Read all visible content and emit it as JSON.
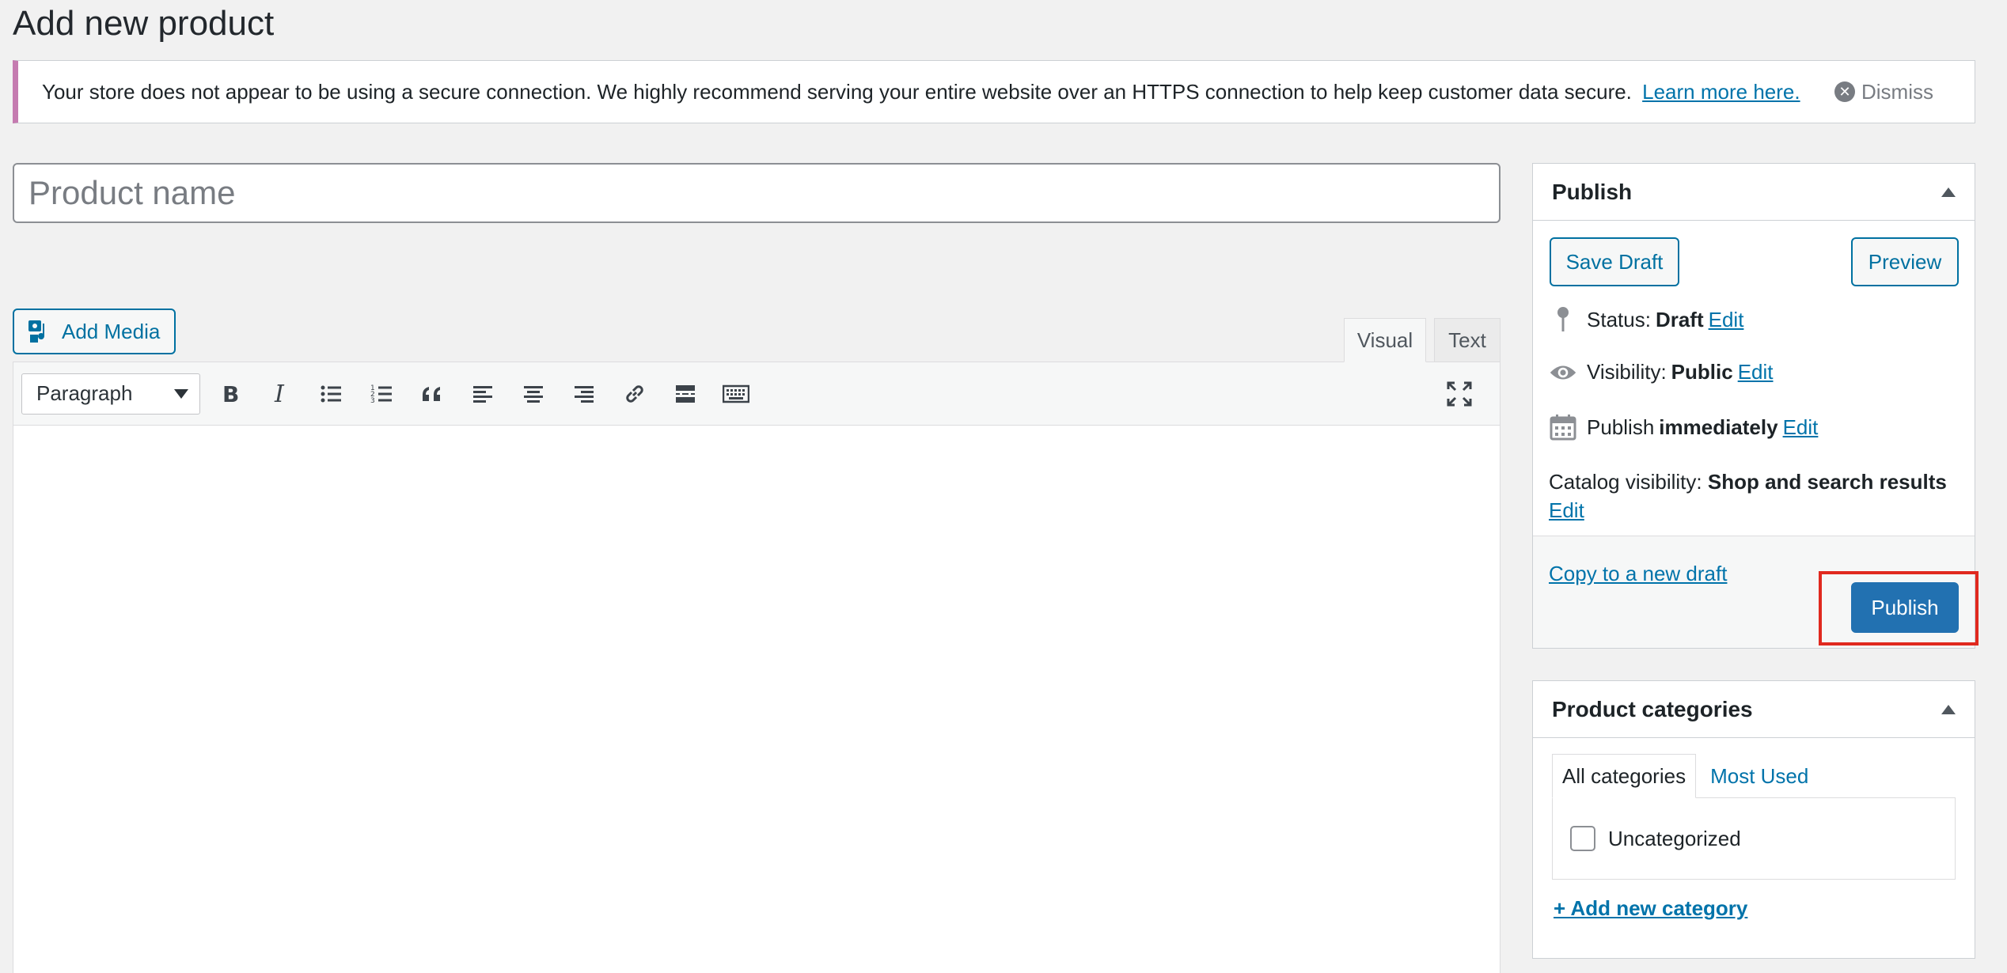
{
  "page": {
    "title": "Add new product"
  },
  "notice": {
    "message": "Your store does not appear to be using a secure connection. We highly recommend serving your entire website over an HTTPS connection to help keep customer data secure.",
    "link": "Learn more here.",
    "dismiss": "Dismiss"
  },
  "title_field": {
    "placeholder": "Product name",
    "value": ""
  },
  "editor": {
    "add_media": "Add Media",
    "tabs": {
      "visual": "Visual",
      "text": "Text"
    },
    "format": "Paragraph"
  },
  "publish": {
    "title": "Publish",
    "save_draft": "Save Draft",
    "preview": "Preview",
    "status_label": "Status:",
    "status_value": "Draft",
    "visibility_label": "Visibility:",
    "visibility_value": "Public",
    "schedule_label": "Publish",
    "schedule_value": "immediately",
    "edit": "Edit",
    "catalog_label": "Catalog visibility:",
    "catalog_value": "Shop and search results",
    "copy_draft": "Copy to a new draft",
    "publish_button": "Publish",
    "highlight_color": "#e0291f",
    "primary_color": "#2271b1"
  },
  "categories": {
    "title": "Product categories",
    "tabs": {
      "all": "All categories",
      "most_used": "Most Used"
    },
    "items": [
      {
        "label": "Uncategorized",
        "checked": false
      }
    ],
    "add_new": "+ Add new category"
  }
}
